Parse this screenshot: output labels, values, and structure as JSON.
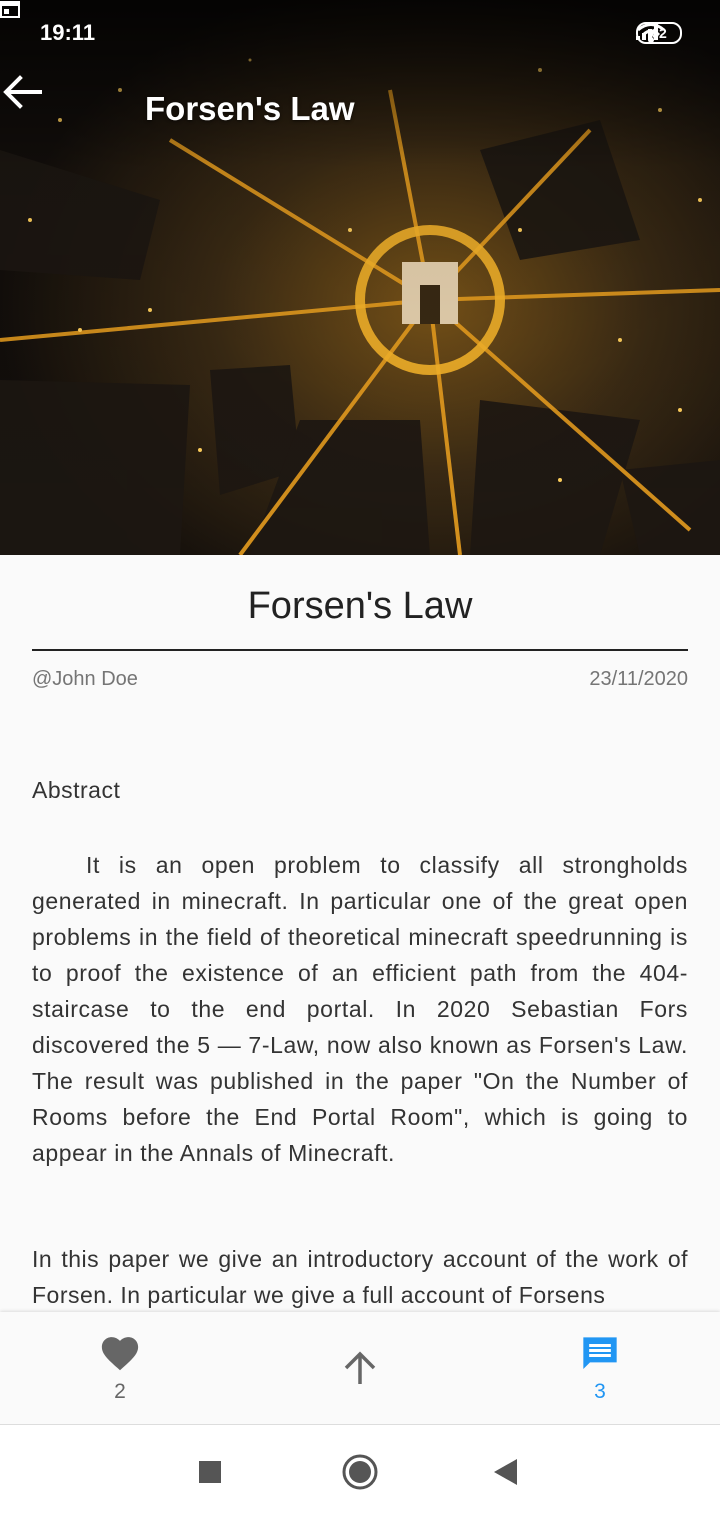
{
  "status_bar": {
    "time": "19:11",
    "battery": "62"
  },
  "app_bar": {
    "title": "Forsen's Law"
  },
  "article": {
    "title": "Forsen's Law",
    "author": "@John Doe",
    "date": "23/11/2020",
    "abstract_heading": "Abstract",
    "abstract_text": "It is an open problem to classify all strongholds generated in minecraft. In particular one of the great open problems in the field of theoretical minecraft speedrunning is to proof the existence of an efficient path from the 404-staircase to the end portal. In 2020 Sebastian Fors discovered the 5 — 7-Law, now also known as Forsen's Law. The result was published in the paper \"On the Number of Rooms before the End Portal Room\", which is going to appear in the Annals of Minecraft.",
    "body_text": "In this paper we give an introductory account of the work of Forsen. In particular we give a full account of Forsens"
  },
  "actions": {
    "likes": "2",
    "comments": "3",
    "like_color": "#666666",
    "comment_color": "#2196f3"
  },
  "icons": {
    "back": "arrow-left-icon",
    "like": "heart-icon",
    "scroll_up": "arrow-up-icon",
    "comments": "comment-icon",
    "nav_recents": "square-icon",
    "nav_home": "circle-icon",
    "nav_back": "triangle-icon"
  }
}
